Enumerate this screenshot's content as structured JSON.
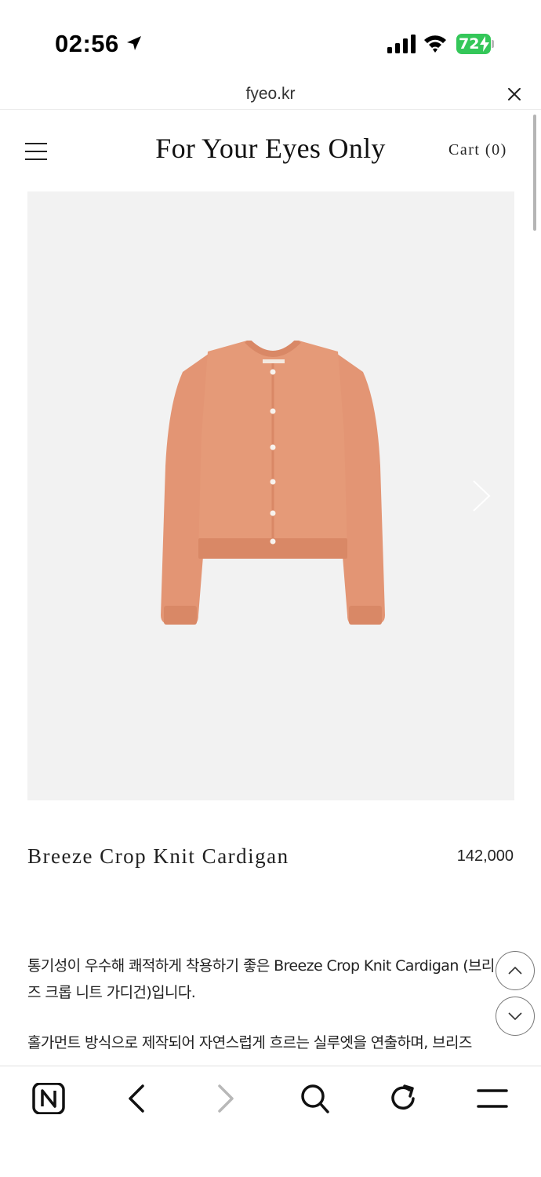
{
  "status_bar": {
    "time": "02:56",
    "battery": "72",
    "icons": [
      "location-arrow-icon",
      "signal-icon",
      "wifi-icon",
      "battery-charging-icon"
    ]
  },
  "browser": {
    "url": "fyeo.kr",
    "close_icon": "close-icon"
  },
  "site": {
    "title": "For Your Eyes Only",
    "cart_label": "Cart (0)",
    "menu_icon": "hamburger-icon"
  },
  "product": {
    "name": "Breeze Crop Knit Cardigan",
    "price": "142,000",
    "image_icon": "cardigan-image",
    "description_p1": "통기성이 우수해 쾌적하게 착용하기 좋은 Breeze Crop Knit Cardigan (브리즈 크롭 니트 가디건)입니다.",
    "description_p2": "홀가먼트 방식으로 제작되어 자연스럽게 흐르는 실루엣을 연출하며, 브리즈"
  },
  "floating_buttons": {
    "up_icon": "chevron-up-icon",
    "down_icon": "chevron-down-icon"
  },
  "toolbar": {
    "icons": [
      "naver-home-icon",
      "back-icon",
      "forward-icon",
      "search-icon",
      "reload-icon",
      "menu-icon"
    ]
  },
  "colors": {
    "battery_green": "#34c759",
    "cardigan": "#e39574",
    "image_bg": "#f2f2f2"
  }
}
